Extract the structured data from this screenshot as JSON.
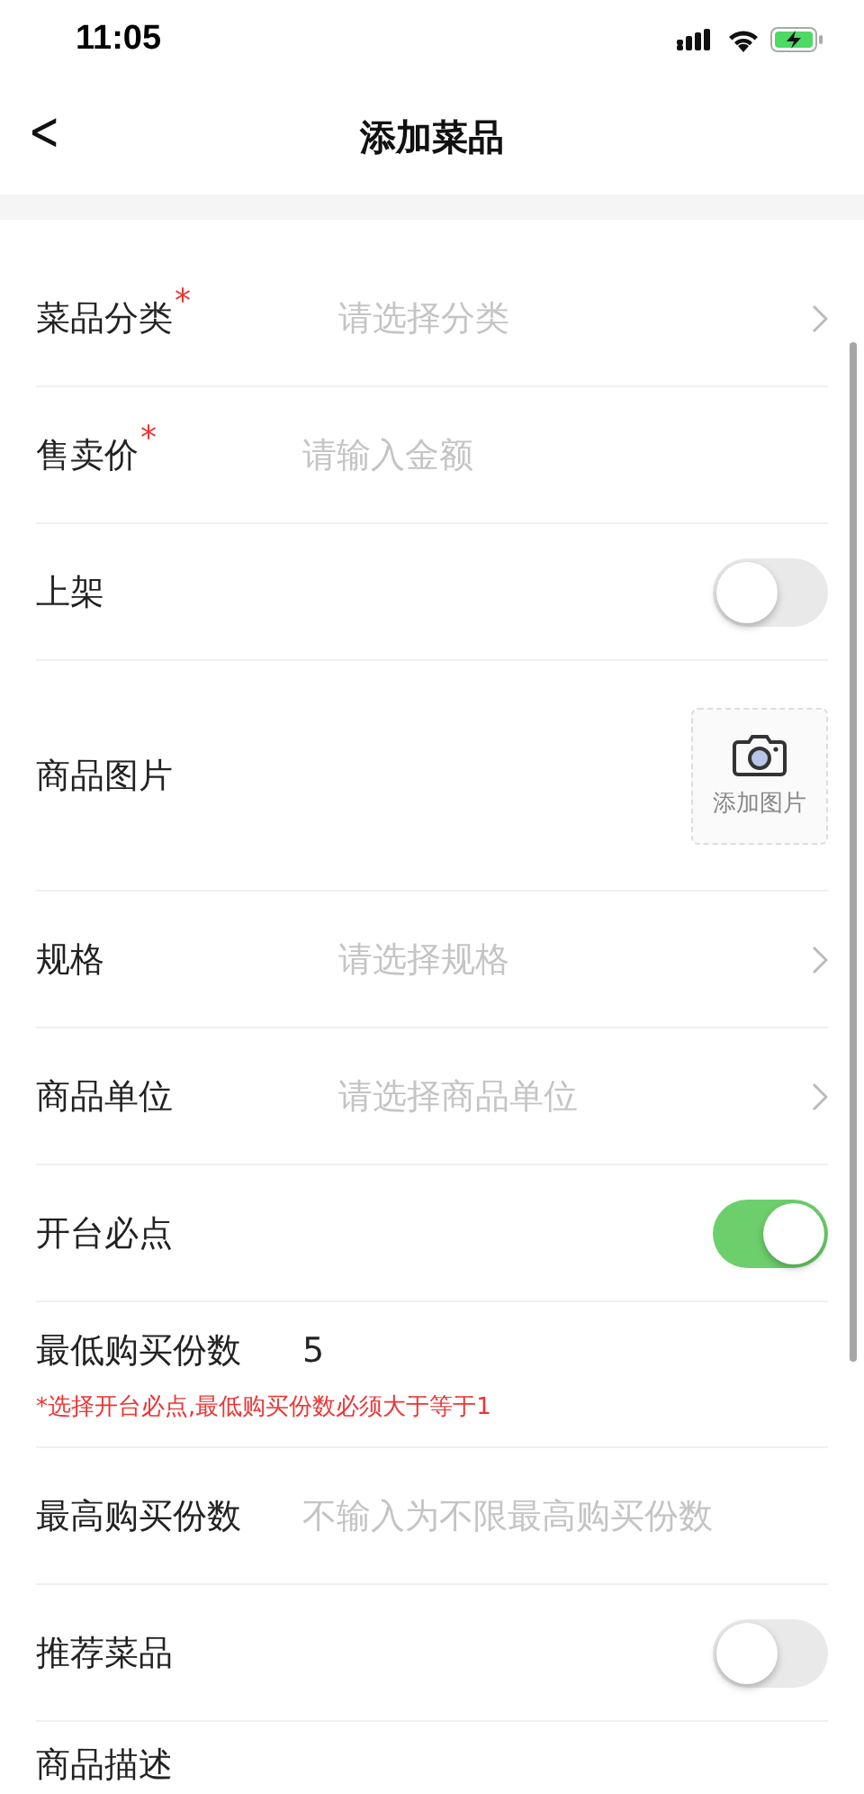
{
  "status_bar": {
    "time": "11:05"
  },
  "nav": {
    "back": "<",
    "title": "添加菜品"
  },
  "fields": [
    {
      "kind": "select",
      "label": "菜品分类",
      "mark": "*",
      "placeholder": "请选择分类"
    },
    {
      "kind": "input",
      "label": "售卖价",
      "mark": "*",
      "placeholder": "请输入金额"
    },
    {
      "kind": "toggle",
      "label": "上架",
      "on": false
    },
    {
      "kind": "image",
      "label": "商品图片",
      "button": "添加图片"
    },
    {
      "kind": "select",
      "label": "规格",
      "placeholder": "请选择规格"
    },
    {
      "kind": "select",
      "label": "商品单位",
      "placeholder": "请选择商品单位"
    },
    {
      "kind": "toggle",
      "label": "开台必点",
      "on": true
    },
    {
      "kind": "input",
      "label": "最低购买份数",
      "value": "5",
      "note": "*选择开台必点,最低购买份数必须大于等于1"
    },
    {
      "kind": "input",
      "label": "最高购买份数",
      "placeholder": "不输入为不限最高购买份数"
    },
    {
      "kind": "toggle",
      "label": "推荐菜品",
      "on": false
    },
    {
      "kind": "label",
      "label": "商品描述"
    }
  ]
}
